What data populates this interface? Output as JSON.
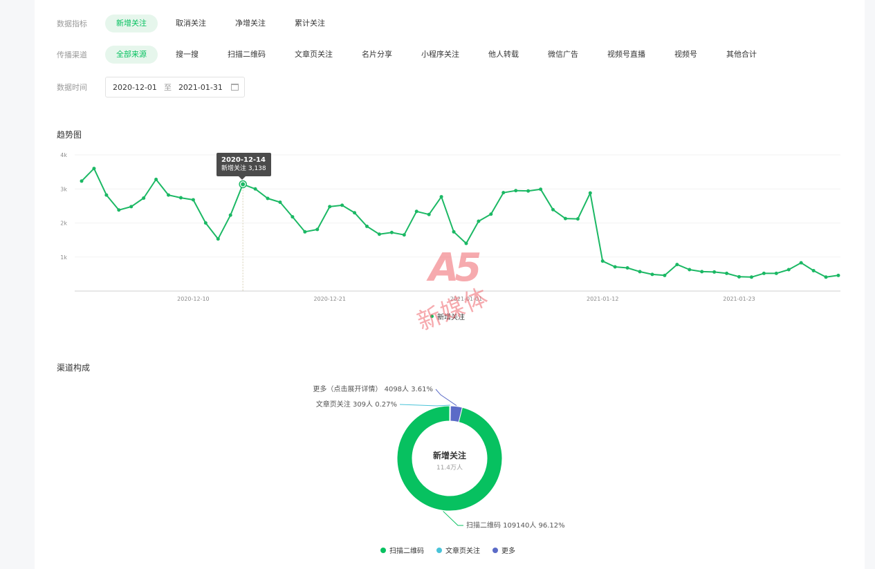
{
  "filters": {
    "metric_label": "数据指标",
    "metrics": [
      "新增关注",
      "取消关注",
      "净增关注",
      "累计关注"
    ],
    "metric_active": 0,
    "channel_label": "传播渠道",
    "channels": [
      "全部来源",
      "搜一搜",
      "扫描二维码",
      "文章页关注",
      "名片分享",
      "小程序关注",
      "他人转载",
      "微信广告",
      "视频号直播",
      "视频号",
      "其他合计"
    ],
    "channel_active": 0,
    "time_label": "数据时间",
    "date_start": "2020-12-01",
    "date_sep": "至",
    "date_end": "2021-01-31"
  },
  "trend": {
    "title": "趋势图",
    "tooltip": {
      "date": "2020-12-14",
      "text": "新增关注 3,138"
    },
    "legend": "新增关注"
  },
  "channel": {
    "title": "渠道构成",
    "center_title": "新增关注",
    "center_value": "11.4万人",
    "labels": {
      "more": "更多（点击展开详情） 4098人 3.61%",
      "article": "文章页关注 309人 0.27%",
      "qr": "扫描二维码 109140人 96.12%"
    },
    "legend": [
      "扫描二维码",
      "文章页关注",
      "更多"
    ]
  },
  "watermark": {
    "logo": "A5",
    "text": "新媒体"
  },
  "colors": {
    "green": "#07c160",
    "cyan": "#49c3d8",
    "blue": "#5b6bc7",
    "active_bg": "#e6f6ec"
  },
  "chart_data": [
    {
      "type": "line",
      "title": "趋势图",
      "x": [
        "2020-12-01",
        "2020-12-02",
        "2020-12-03",
        "2020-12-04",
        "2020-12-05",
        "2020-12-06",
        "2020-12-07",
        "2020-12-08",
        "2020-12-09",
        "2020-12-10",
        "2020-12-11",
        "2020-12-12",
        "2020-12-13",
        "2020-12-14",
        "2020-12-15",
        "2020-12-16",
        "2020-12-17",
        "2020-12-18",
        "2020-12-19",
        "2020-12-20",
        "2020-12-21",
        "2020-12-22",
        "2020-12-23",
        "2020-12-24",
        "2020-12-25",
        "2020-12-26",
        "2020-12-27",
        "2020-12-28",
        "2020-12-29",
        "2020-12-30",
        "2020-12-31",
        "2021-01-01",
        "2021-01-02",
        "2021-01-03",
        "2021-01-04",
        "2021-01-05",
        "2021-01-06",
        "2021-01-07",
        "2021-01-08",
        "2021-01-09",
        "2021-01-10",
        "2021-01-11",
        "2021-01-12",
        "2021-01-13",
        "2021-01-14",
        "2021-01-15",
        "2021-01-16",
        "2021-01-17",
        "2021-01-18",
        "2021-01-19",
        "2021-01-20",
        "2021-01-21",
        "2021-01-22",
        "2021-01-23",
        "2021-01-24",
        "2021-01-25",
        "2021-01-26",
        "2021-01-27",
        "2021-01-28",
        "2021-01-29",
        "2021-01-30",
        "2021-01-31"
      ],
      "series": [
        {
          "name": "新增关注",
          "values": [
            3230,
            3600,
            2820,
            2380,
            2480,
            2730,
            3280,
            2820,
            2740,
            2680,
            2000,
            1530,
            2230,
            3138,
            3000,
            2720,
            2610,
            2180,
            1740,
            1810,
            2480,
            2520,
            2300,
            1900,
            1670,
            1720,
            1650,
            2340,
            2250,
            2770,
            1740,
            1400,
            2050,
            2260,
            2890,
            2950,
            2940,
            2990,
            2390,
            2130,
            2120,
            2880,
            880,
            710,
            680,
            570,
            490,
            460,
            780,
            630,
            570,
            560,
            520,
            420,
            410,
            520,
            520,
            630,
            830,
            600,
            410,
            460
          ]
        }
      ],
      "ylim": [
        0,
        4000
      ],
      "yticks": [
        0,
        1000,
        2000,
        3000,
        4000
      ],
      "yticklabels": [
        "",
        "1k",
        "2k",
        "3k",
        "4k"
      ],
      "xticklabels": [
        "2020-12-10",
        "2020-12-21",
        "2021-01-01",
        "2021-01-12",
        "2021-01-23"
      ],
      "legend": "bottom-center",
      "grid": true
    },
    {
      "type": "pie",
      "title": "渠道构成",
      "categories": [
        "扫描二维码",
        "文章页关注",
        "更多"
      ],
      "values": [
        109140,
        309,
        4098
      ],
      "percentages": [
        96.12,
        0.27,
        3.61
      ],
      "legend": "bottom-center"
    }
  ]
}
